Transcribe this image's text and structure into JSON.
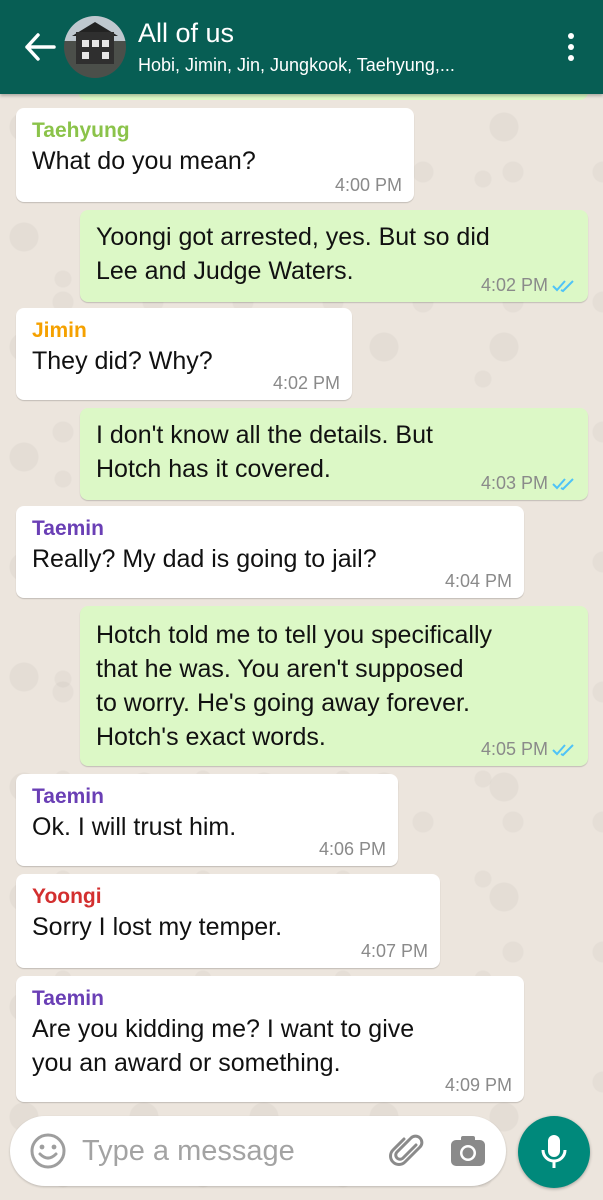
{
  "header": {
    "title": "All of us",
    "subtitle": "Hobi, Jimin, Jin, Jungkook, Taehyung,...",
    "colors": {
      "bar": "#075e54"
    }
  },
  "messages": [
    {
      "type": "in",
      "sender": "Taehyung",
      "sender_color": "#8bc34a",
      "lines": [
        "What do you mean?"
      ],
      "time": "4:00 PM"
    },
    {
      "type": "out",
      "lines": [
        "Yoongi got arrested, yes. But so did",
        "Lee and Judge Waters."
      ],
      "time": "4:02 PM",
      "read": true
    },
    {
      "type": "in",
      "sender": "Jimin",
      "sender_color": "#f5a100",
      "lines": [
        "They did? Why?"
      ],
      "time": "4:02 PM"
    },
    {
      "type": "out",
      "lines": [
        "I don't know all the details. But",
        "Hotch has it covered."
      ],
      "time": "4:03 PM",
      "read": true
    },
    {
      "type": "in",
      "sender": "Taemin",
      "sender_color": "#6a3fb5",
      "lines": [
        "Really? My dad is going to jail?"
      ],
      "time": "4:04 PM"
    },
    {
      "type": "out",
      "lines": [
        "Hotch told me to tell you specifically",
        "that he was. You aren't supposed",
        "to worry. He's going away forever.",
        "Hotch's exact words."
      ],
      "time": "4:05 PM",
      "read": true
    },
    {
      "type": "in",
      "sender": "Taemin",
      "sender_color": "#6a3fb5",
      "lines": [
        "Ok. I will trust him."
      ],
      "time": "4:06 PM"
    },
    {
      "type": "in",
      "sender": "Yoongi",
      "sender_color": "#d32f2f",
      "lines": [
        "Sorry I lost my temper."
      ],
      "time": "4:07 PM"
    },
    {
      "type": "in",
      "sender": "Taemin",
      "sender_color": "#6a3fb5",
      "lines": [
        "Are you kidding me? I want to give",
        "you an award or something."
      ],
      "time": "4:09 PM"
    }
  ],
  "composer": {
    "placeholder": "Type a message",
    "icons": [
      "emoji-icon",
      "paperclip-icon",
      "camera-icon",
      "microphone-icon"
    ]
  },
  "colors": {
    "incoming_bubble": "#ffffff",
    "outgoing_bubble": "#dcf8c6",
    "read_ticks": "#4fc3f7",
    "mic_button": "#00897b"
  }
}
